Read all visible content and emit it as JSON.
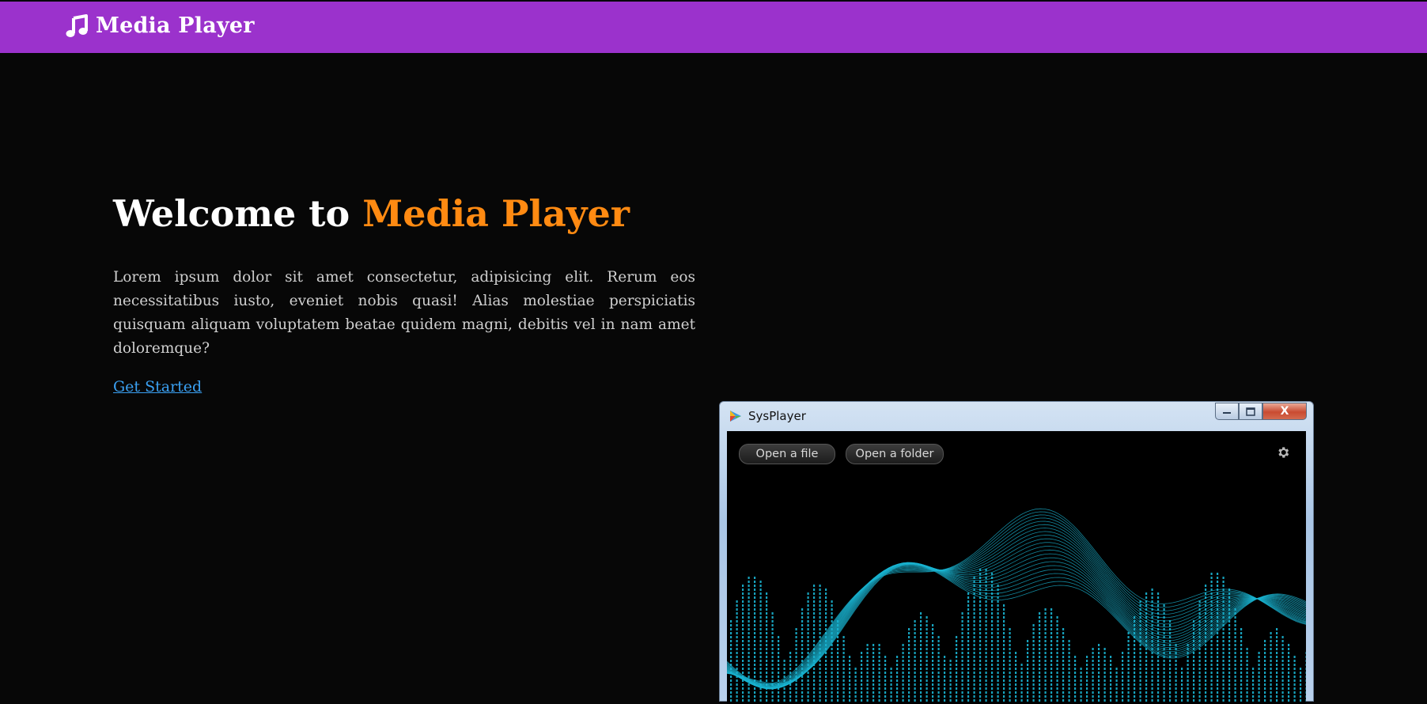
{
  "navbar": {
    "brand": "Media Player",
    "color": "#9b32cc",
    "icon": "music-note-icon"
  },
  "hero": {
    "title_prefix": "Welcome to",
    "title_accent": "Media Player",
    "accent_color": "#ff8a12",
    "description": "Lorem ipsum dolor sit amet consectetur, adipisicing elit. Rerum eos necessitatibus iusto, eveniet nobis quasi! Alias molestiae perspiciatis quisquam aliquam voluptatem beatae quidem magni, debitis vel in nam amet doloremque?",
    "cta_label": "Get Started"
  },
  "screenshot": {
    "window_title": "SysPlayer",
    "close_glyph": "X",
    "buttons": {
      "open_file": "Open a file",
      "open_folder": "Open a folder"
    },
    "visualizer_color": "#19b4d2"
  }
}
